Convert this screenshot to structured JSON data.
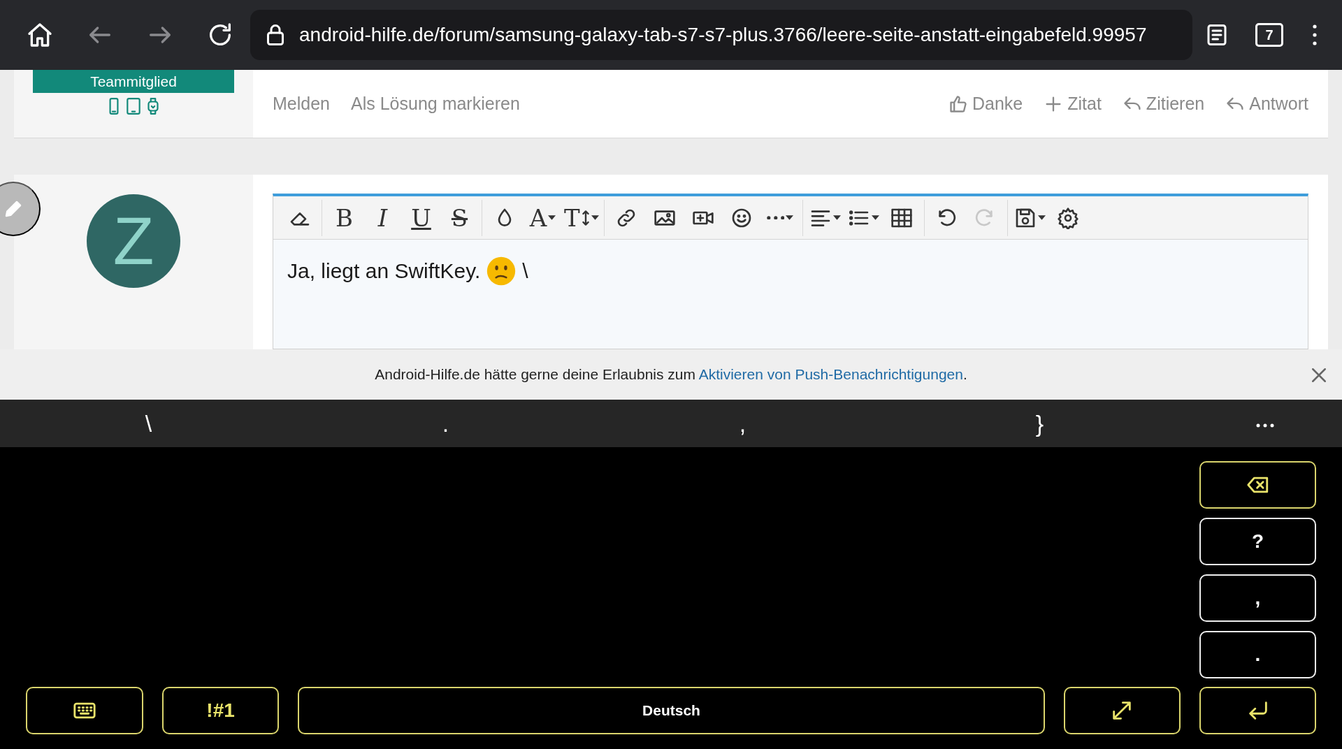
{
  "browser": {
    "nav": [
      {
        "kind": "home",
        "disabled": false
      },
      {
        "kind": "back",
        "disabled": true
      },
      {
        "kind": "forward",
        "disabled": true
      },
      {
        "kind": "reload",
        "disabled": false
      }
    ],
    "url": "android-hilfe.de/forum/samsung-galaxy-tab-s7-s7-plus.3766/leere-seite-anstatt-eingabefeld.99957",
    "tab_count": "7"
  },
  "post": {
    "user_title": "Teammitglied",
    "actions_left": [
      "Melden",
      "Als Lösung markieren"
    ],
    "actions_right": [
      {
        "kind": "like",
        "label": "Danke"
      },
      {
        "kind": "plus",
        "label": "Zitat"
      },
      {
        "kind": "reply",
        "label": "Zitieren"
      },
      {
        "kind": "reply",
        "label": "Antwort"
      }
    ]
  },
  "reply": {
    "avatar_letter": "Z",
    "toolbar": [
      [
        {
          "kind": "eraser",
          "disabled": false
        }
      ],
      [
        {
          "kind": "bold",
          "glyph": "B",
          "disabled": false
        },
        {
          "kind": "italic",
          "glyph": "I",
          "disabled": false
        },
        {
          "kind": "underline",
          "glyph": "U",
          "disabled": false
        },
        {
          "kind": "strike",
          "glyph": "S",
          "disabled": false
        }
      ],
      [
        {
          "kind": "drop",
          "disabled": false
        },
        {
          "kind": "font",
          "glyph": "A",
          "dropdown": true,
          "disabled": false
        },
        {
          "kind": "size",
          "glyph": "T",
          "dropdown": true,
          "disabled": false
        }
      ],
      [
        {
          "kind": "link",
          "disabled": false
        },
        {
          "kind": "image",
          "disabled": false
        },
        {
          "kind": "video",
          "disabled": false
        },
        {
          "kind": "smiley",
          "disabled": false
        },
        {
          "kind": "more",
          "dropdown": true,
          "disabled": false
        }
      ],
      [
        {
          "kind": "align",
          "dropdown": true,
          "disabled": false
        },
        {
          "kind": "list",
          "dropdown": true,
          "disabled": false
        },
        {
          "kind": "table",
          "disabled": false
        }
      ],
      [
        {
          "kind": "undo",
          "disabled": false
        },
        {
          "kind": "redo",
          "disabled": true
        }
      ],
      [
        {
          "kind": "save",
          "dropdown": true,
          "disabled": false
        },
        {
          "kind": "gear",
          "disabled": false
        }
      ]
    ],
    "content": [
      {
        "kind": "text",
        "text": "Ja, liegt an SwiftKey."
      },
      {
        "kind": "emoji"
      },
      {
        "kind": "text",
        "text": "\\"
      }
    ]
  },
  "notification": {
    "before": "Android-Hilfe.de hätte gerne deine Erlaubnis zum ",
    "link": "Aktivieren von Push-Benachrichtigungen",
    "after": "."
  },
  "keyboard": {
    "suggestions": [
      "\\",
      ".",
      ",",
      "}"
    ],
    "side_keys": [
      {
        "kind": "backspace"
      },
      {
        "kind": "char",
        "label": "?"
      },
      {
        "kind": "char",
        "label": ","
      },
      {
        "kind": "char",
        "label": "."
      },
      {
        "kind": "enter"
      }
    ],
    "bottom_keys": [
      {
        "kind": "keyboard"
      },
      {
        "kind": "symbols",
        "label": "!#1"
      },
      {
        "kind": "space",
        "label": "Deutsch"
      },
      {
        "kind": "resize"
      }
    ]
  }
}
